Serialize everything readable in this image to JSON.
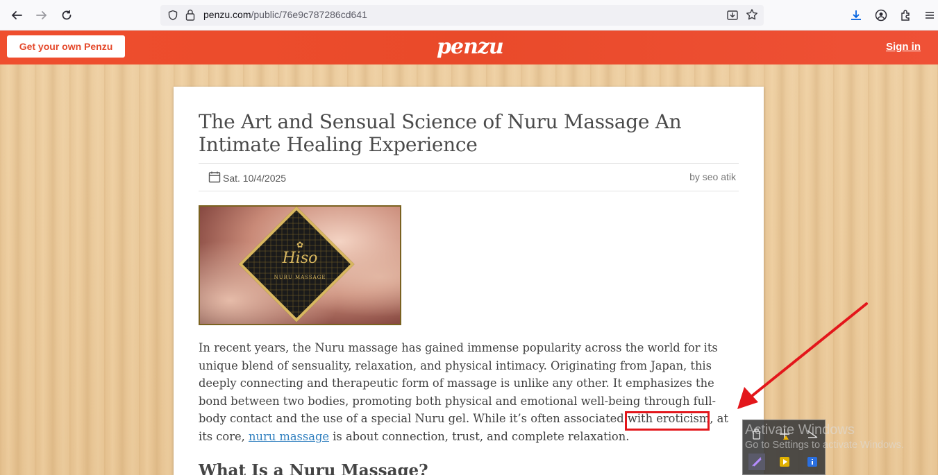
{
  "browser": {
    "url_domain": "penzu.com",
    "url_path": "/public/76e9c787286cd641"
  },
  "header": {
    "get_penzu_label": "Get your own Penzu",
    "logo_text": "penzu",
    "sign_in_label": "Sign in"
  },
  "article": {
    "title": "The Art and Sensual Science of Nuru Massage An Intimate Healing Experience",
    "date": "Sat. 10/4/2025",
    "author": "by seo atik",
    "image": {
      "brand": "Hiso",
      "subtitle": "NURU MASSAGE"
    },
    "paragraph_before_link": "In recent years, the Nuru massage has gained immense popularity across the world for its unique blend of sensuality, relaxation, and physical intimacy. Originating from Japan, this deeply connecting and therapeutic form of massage is unlike any other. It emphasizes the bond between two bodies, promoting both physical and emotional well-being through full-body contact and the use of a special Nuru gel. While it’s often associated with eroticism, at its core,",
    "link_text": "nuru massage",
    "paragraph_after_link": " is about connection, trust, and complete relaxation.",
    "heading2": "What Is a Nuru Massage?"
  },
  "overlay": {
    "activate_title": "Activate Windows",
    "activate_sub": "Go to Settings to activate Windows.",
    "highlight_color": "#e3161b"
  },
  "colors": {
    "brand": "#ef4e2e",
    "link": "#2f7fbf"
  }
}
